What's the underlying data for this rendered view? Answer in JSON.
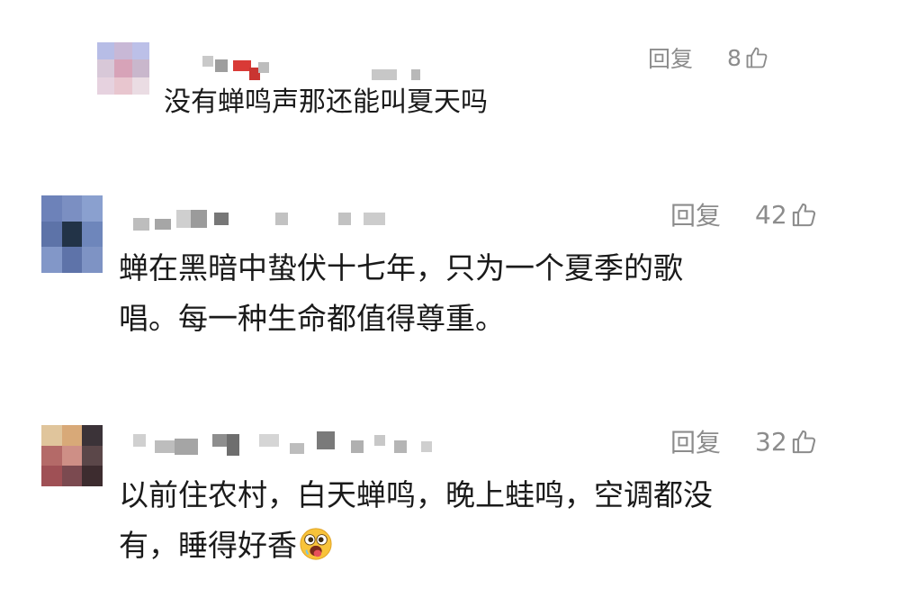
{
  "comments": [
    {
      "reply_label": "回复",
      "likes": "8",
      "text": "没有蝉鸣声那还能叫夏天吗",
      "avatar_colors": [
        "#b7bde6",
        "#c8b8d6",
        "#bcc0e8",
        "#d8c8d8",
        "#d7a3b8",
        "#c9b7cc",
        "#e6d2df",
        "#e8c6cf",
        "#eadce3"
      ]
    },
    {
      "reply_label": "回复",
      "likes": "42",
      "text": "蝉在黑暗中蛰伏十七年，只为一个夏季的歌\n唱。每一种生命都值得尊重。",
      "avatar_colors": [
        "#6d82b9",
        "#7b8fc2",
        "#8aa0cf",
        "#5d73a8",
        "#223347",
        "#6e86bb",
        "#8297c8",
        "#5e73a9",
        "#7e93c4"
      ]
    },
    {
      "reply_label": "回复",
      "likes": "32",
      "text": "以前住农村，白天蝉鸣，晚上蛙鸣，空调都没\n有，睡得好香",
      "avatar_colors": [
        "#e0c59c",
        "#d8a978",
        "#3b3338",
        "#b46a68",
        "#ce8f86",
        "#5b4749",
        "#9f5055",
        "#7b4a50",
        "#3d2c2f"
      ]
    }
  ],
  "icons": {
    "thumb": "thumbs-up-icon",
    "emoji": "drooling-face-emoji"
  }
}
